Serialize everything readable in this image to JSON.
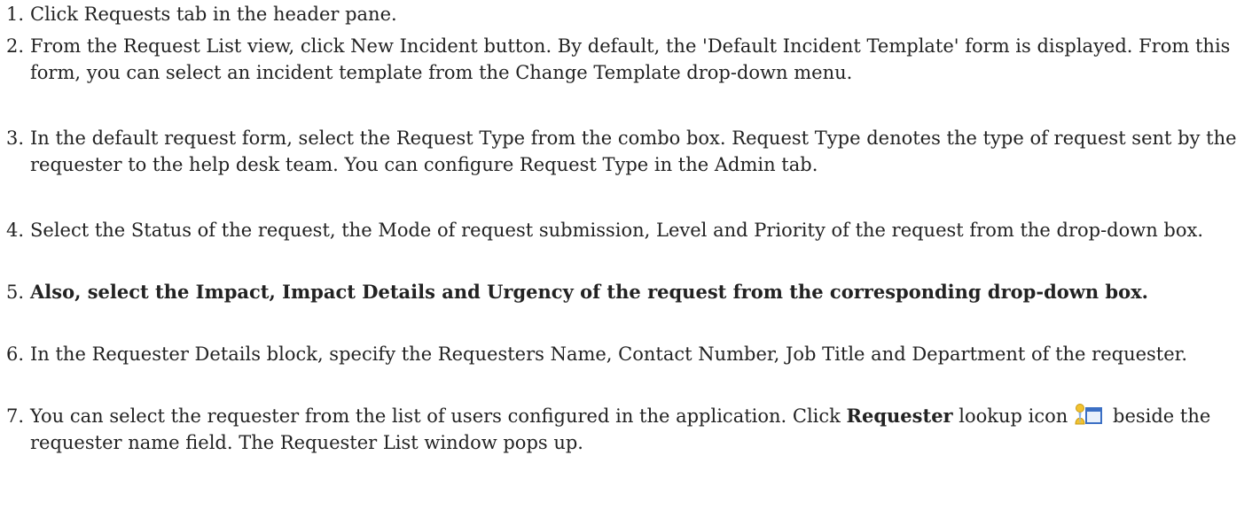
{
  "steps": [
    {
      "number": "1.",
      "text": "Click Requests tab in the header pane."
    },
    {
      "number": "2.",
      "text": "From the Request List view, click New Incident button. By default, the 'Default Incident Template' form is displayed. From this form, you can select an incident template from the Change Template drop-down menu."
    },
    {
      "number": "3.",
      "text": "In the default request form, select the Request Type from the combo box. Request Type denotes the type of request sent by the requester to the help desk team. You can configure Request Type in the Admin tab."
    },
    {
      "number": "4.",
      "text": "Select the Status of the request, the Mode of request submission, Level and Priority of the request from the drop-down box."
    },
    {
      "number": "5.",
      "text": "Also, select the Impact, Impact Details and Urgency of the request from the corresponding drop-down box."
    },
    {
      "number": "6.",
      "text": "In the Requester Details block, specify the Requesters Name, Contact Number, Job Title and Department of the requester."
    },
    {
      "number": "7.",
      "text_before": "You can select the requester from the list of users configured in the application. Click ",
      "bold_text": "Requester",
      "text_middle": " lookup icon",
      "icon": "requester-lookup-icon",
      "text_after": " beside the requester name field. The Requester List window pops up."
    }
  ],
  "colors": {
    "text": "#222222",
    "icon_person": "#f2c230",
    "icon_box": "#3b6fc4"
  }
}
